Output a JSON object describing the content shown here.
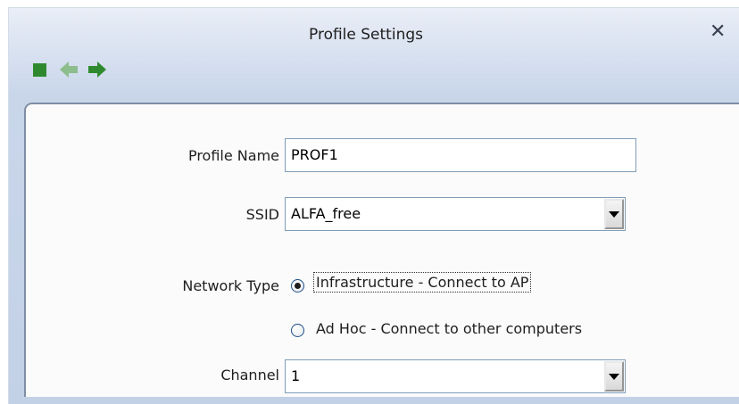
{
  "window": {
    "title": "Profile Settings",
    "close_icon": "close-icon"
  },
  "toolbar": {
    "buttons": [
      {
        "name": "stop",
        "icon": "square-icon",
        "color": "#2f8a2f"
      },
      {
        "name": "back",
        "icon": "left-arrow-icon",
        "color": "#8dbd8d"
      },
      {
        "name": "forward",
        "icon": "right-arrow-icon",
        "color": "#2f8a2f"
      }
    ]
  },
  "form": {
    "profile_name_label": "Profile Name",
    "profile_name_value": "PROF1",
    "ssid_label": "SSID",
    "ssid_value": "ALFA_free",
    "network_type_label": "Network Type",
    "network_type_options": [
      {
        "label": "Infrastructure - Connect to AP",
        "selected": true
      },
      {
        "label": "Ad Hoc - Connect to other computers",
        "selected": false
      }
    ],
    "channel_label": "Channel",
    "channel_value": "1"
  },
  "colors": {
    "accent_green": "#2f8a2f",
    "disabled_green": "#8dbd8d",
    "panel_border": "#7f8da5"
  }
}
